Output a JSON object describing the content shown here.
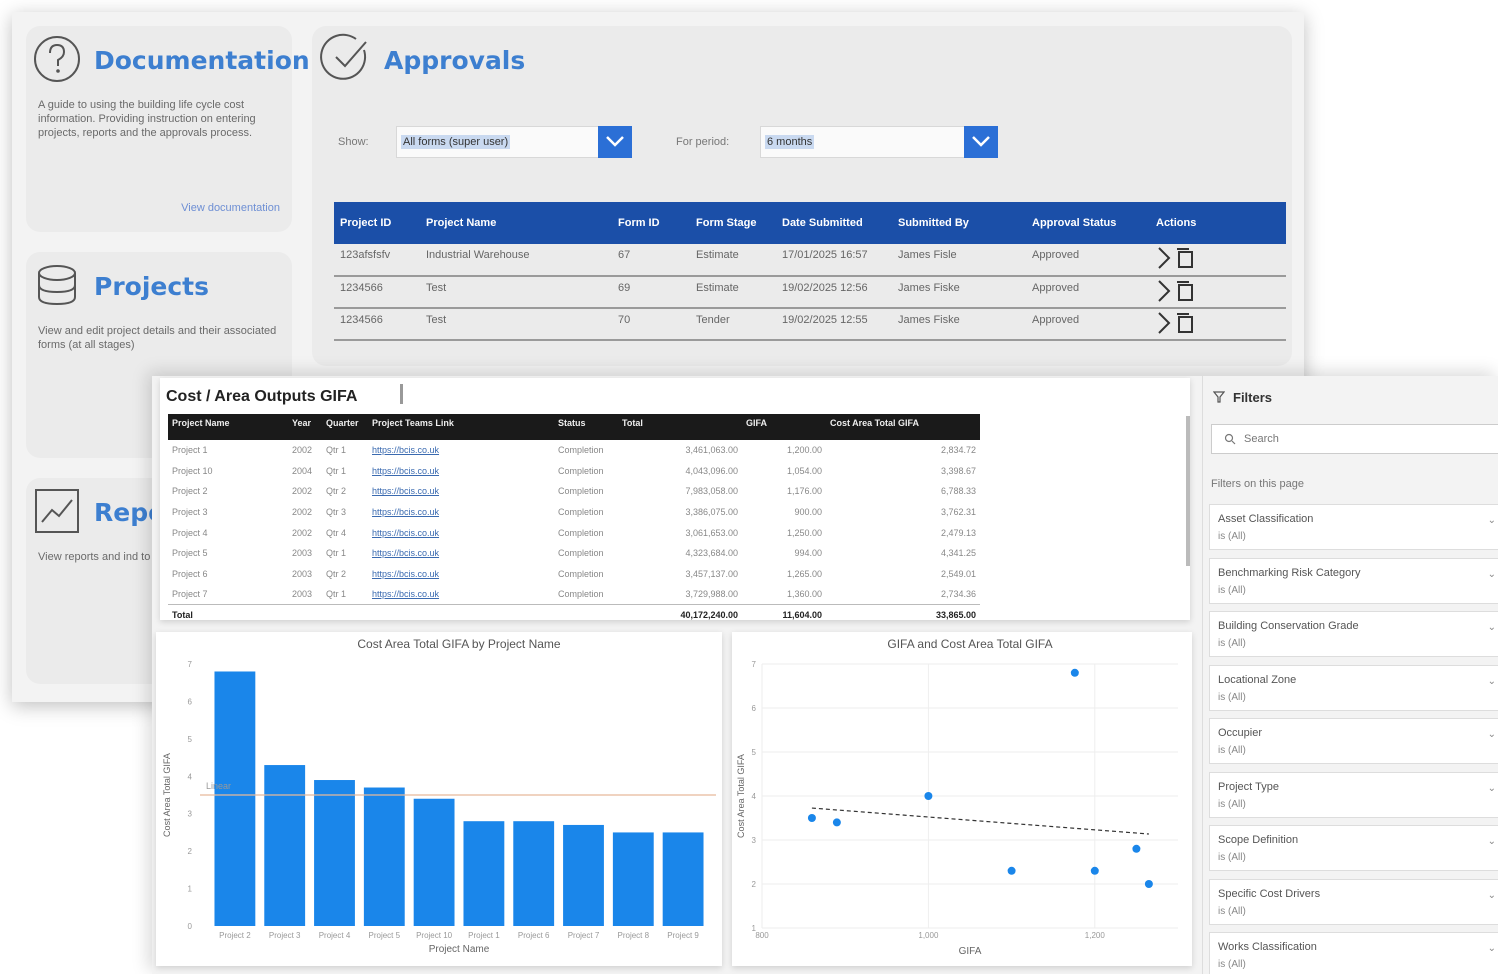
{
  "portal": {
    "documentation": {
      "title": "Documentation",
      "description": "A guide to using the building life cycle cost information. Providing instruction on entering projects, reports and the approvals process.",
      "link": "View documentation"
    },
    "projects": {
      "title": "Projects",
      "description": "View and edit project details and their associated forms (at all stages)"
    },
    "reports": {
      "title": "Repo",
      "description": "View reports and ind to gain insight into y"
    },
    "approvals": {
      "title": "Approvals",
      "show_label": "Show:",
      "show_value": "All forms (super user)",
      "period_label": "For period:",
      "period_value": "6 months",
      "columns": [
        "Project ID",
        "Project Name",
        "Form ID",
        "Form Stage",
        "Date Submitted",
        "Submitted By",
        "Approval Status",
        "Actions"
      ],
      "rows": [
        [
          "123afsfsfv",
          "Industrial Warehouse",
          "67",
          "Estimate",
          "17/01/2025 16:57",
          "James Fisle",
          "Approved"
        ],
        [
          "1234566",
          "Test",
          "69",
          "Estimate",
          "19/02/2025 12:56",
          "James Fiske",
          "Approved"
        ],
        [
          "1234566",
          "Test",
          "70",
          "Tender",
          "19/02/2025 12:55",
          "James Fiske",
          "Approved"
        ]
      ]
    }
  },
  "report": {
    "title": "Cost / Area Outputs GIFA",
    "table": {
      "columns": [
        "Project Name",
        "Year",
        "Quarter",
        "Project Teams Link",
        "Status",
        "Total",
        "GIFA",
        "Cost Area Total GIFA"
      ],
      "rows": [
        [
          "Project 1",
          "2002",
          "Qtr 1",
          "https://bcis.co.uk",
          "Completion",
          "3,461,063.00",
          "1,200.00",
          "2,834.72"
        ],
        [
          "Project 10",
          "2004",
          "Qtr 1",
          "https://bcis.co.uk",
          "Completion",
          "4,043,096.00",
          "1,054.00",
          "3,398.67"
        ],
        [
          "Project 2",
          "2002",
          "Qtr 2",
          "https://bcis.co.uk",
          "Completion",
          "7,983,058.00",
          "1,176.00",
          "6,788.33"
        ],
        [
          "Project 3",
          "2002",
          "Qtr 3",
          "https://bcis.co.uk",
          "Completion",
          "3,386,075.00",
          "900.00",
          "3,762.31"
        ],
        [
          "Project 4",
          "2002",
          "Qtr 4",
          "https://bcis.co.uk",
          "Completion",
          "3,061,653.00",
          "1,250.00",
          "2,479.13"
        ],
        [
          "Project 5",
          "2003",
          "Qtr 1",
          "https://bcis.co.uk",
          "Completion",
          "4,323,684.00",
          "994.00",
          "4,341.25"
        ],
        [
          "Project 6",
          "2003",
          "Qtr 2",
          "https://bcis.co.uk",
          "Completion",
          "3,457,137.00",
          "1,265.00",
          "2,549.01"
        ],
        [
          "Project 7",
          "2003",
          "Qtr 1",
          "https://bcis.co.uk",
          "Completion",
          "3,729,988.00",
          "1,360.00",
          "2,734.36"
        ]
      ],
      "total": [
        "Total",
        "",
        "",
        "",
        "",
        "40,172,240.00",
        "11,604.00",
        "33,865.00"
      ]
    },
    "filters": {
      "header": "Filters",
      "search_placeholder": "Search",
      "on_page": "Filters on this page",
      "items": [
        {
          "name": "Asset Classification",
          "value": "is (All)"
        },
        {
          "name": "Benchmarking Risk Category",
          "value": "is (All)"
        },
        {
          "name": "Building Conservation Grade",
          "value": "is (All)"
        },
        {
          "name": "Locational Zone",
          "value": "is (All)"
        },
        {
          "name": "Occupier",
          "value": "is (All)"
        },
        {
          "name": "Project Type",
          "value": "is (All)"
        },
        {
          "name": "Scope Definition",
          "value": "is (All)"
        },
        {
          "name": "Specific Cost Drivers",
          "value": "is (All)"
        },
        {
          "name": "Works Classification",
          "value": "is (All)"
        }
      ]
    }
  },
  "chart_data": [
    {
      "type": "bar",
      "title": "Cost Area Total GIFA by Project Name",
      "xlabel": "Project Name",
      "ylabel": "Cost Area Total GIFA",
      "categories": [
        "Project 2",
        "Project 3",
        "Project 4",
        "Project 5",
        "Project 10",
        "Project 1",
        "Project 6",
        "Project 7",
        "Project 8",
        "Project 9"
      ],
      "values": [
        6.8,
        4.3,
        3.9,
        3.7,
        3.4,
        2.8,
        2.8,
        2.7,
        2.5,
        2.5
      ],
      "ylim": [
        0,
        7
      ],
      "yticks": [
        "0",
        "1",
        "2",
        "3",
        "4",
        "5",
        "6",
        "7"
      ],
      "reference_line": {
        "label": "Linear",
        "value": 3.5
      },
      "colors": {
        "bar": "#1a86ea",
        "reference": "#e7b99a"
      }
    },
    {
      "type": "scatter",
      "title": "GIFA and Cost Area Total GIFA",
      "xlabel": "GIFA",
      "ylabel": "Cost Area Total GIFA",
      "x": [
        860,
        890,
        1000,
        1100,
        1176,
        1200,
        1250,
        1265
      ],
      "y": [
        3.5,
        3.4,
        4.0,
        2.3,
        6.8,
        2.3,
        2.8,
        2.0
      ],
      "xlim": [
        800,
        1300
      ],
      "ylim": [
        1,
        7
      ],
      "xticks": [
        "800",
        "1,000",
        "1,200"
      ],
      "yticks": [
        "1",
        "2",
        "3",
        "4",
        "5",
        "6",
        "7"
      ],
      "trendline": true,
      "colors": {
        "point": "#1a86ea",
        "trend": "#333333"
      }
    }
  ]
}
